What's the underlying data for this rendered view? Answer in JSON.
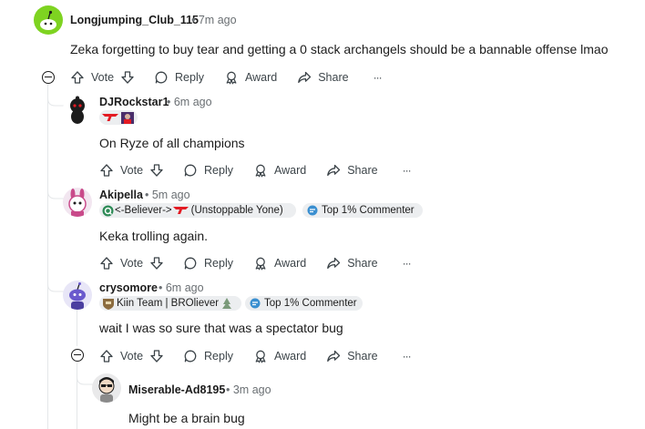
{
  "actions": {
    "vote": "Vote",
    "reply": "Reply",
    "award": "Award",
    "share": "Share",
    "more": "···"
  },
  "comments": [
    {
      "username": "Longjumping_Club_115",
      "time": "7m ago",
      "body": "Zeka forgetting to buy tear and getting a 0 stack archangels should be a bannable offense lmao",
      "avatar_color": "#7ed321"
    },
    {
      "username": "DJRockstar1",
      "time": "6m ago",
      "body": "On Ryze of all champions",
      "avatar_color": "#1c1c1c"
    },
    {
      "username": "Akipella",
      "time": "5m ago",
      "flair": "<-Believer->",
      "flair_suffix": "(Unstoppable Yone)",
      "badge": "Top 1% Commenter",
      "body": "Keka trolling again.",
      "avatar_color": "#c94a8a"
    },
    {
      "username": "crysomore",
      "time": "6m ago",
      "flair": "Kiin Team | BROliever",
      "badge": "Top 1% Commenter",
      "body": "wait I was so sure that was a spectator bug",
      "avatar_color": "#6a5acd"
    },
    {
      "username": "Miserable-Ad8195",
      "time": "3m ago",
      "body": "Might be a brain bug",
      "avatar_color": "#d0d0d0"
    }
  ],
  "colors": {
    "accent_red": "#e31b23",
    "meta_gray": "#6a6f73",
    "thread_line": "#e4e7e9",
    "badge_bg": "#eceef0"
  }
}
